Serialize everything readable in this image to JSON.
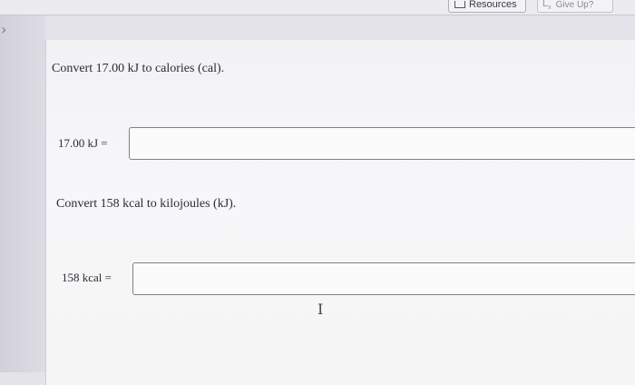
{
  "toolbar": {
    "resources_label": "Resources",
    "give_up_label": "Give Up?"
  },
  "questions": [
    {
      "prompt": "Convert 17.00 kJ to calories (cal).",
      "input_label": "17.00 kJ =",
      "value": ""
    },
    {
      "prompt": "Convert 158 kcal to kilojoules (kJ).",
      "input_label": "158 kcal =",
      "value": ""
    }
  ],
  "icons": {
    "resources": "resources-icon",
    "give_up": "hint-icon",
    "back": "chevron-right-icon",
    "cursor": "text-cursor-icon"
  }
}
